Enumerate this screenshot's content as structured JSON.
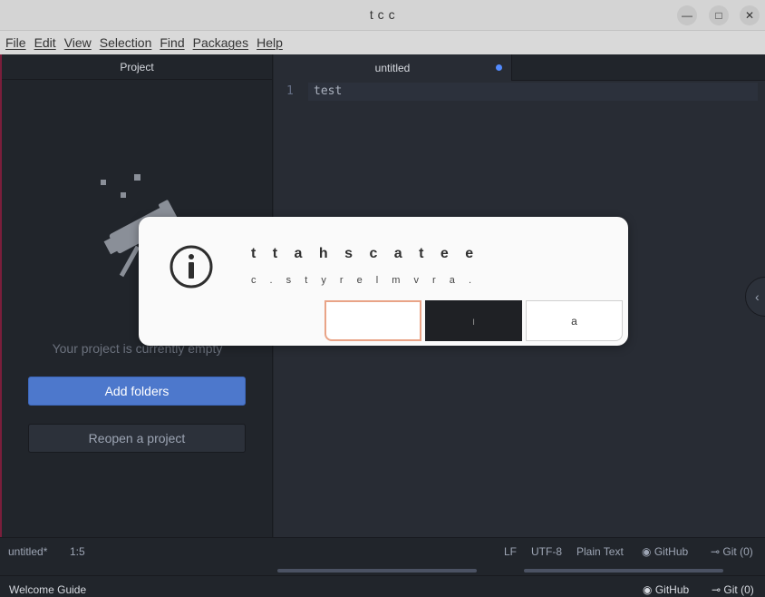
{
  "window": {
    "title": "t  c     c"
  },
  "menu": [
    "File",
    "Edit",
    "View",
    "Selection",
    "Find",
    "Packages",
    "Help"
  ],
  "tree": {
    "header": "Project",
    "empty_message": "Your project is currently empty",
    "add_folders": "Add folders",
    "reopen_project": "Reopen a project"
  },
  "tab": {
    "title": "untitled"
  },
  "editor": {
    "line_number": "1",
    "line_text": "test"
  },
  "status": {
    "file": "untitled*",
    "cursor": "1:5",
    "line_ending": "LF",
    "encoding": "UTF-8",
    "grammar": "Plain Text",
    "github": "GitHub",
    "git": "Git (0)"
  },
  "bottom": {
    "welcome": "Welcome Guide",
    "github": "GitHub",
    "git": "Git (0)"
  },
  "dialog": {
    "message": "t t  a  h   s c   a t  e  e",
    "detail": "c  .  s  t    y  r e l    m v    r a .",
    "buttons": [
      "",
      "ı",
      "a"
    ]
  },
  "colors": {
    "accent": "#4d78cc",
    "modified": "#528bff",
    "dialog_focus": "#e9a487"
  }
}
